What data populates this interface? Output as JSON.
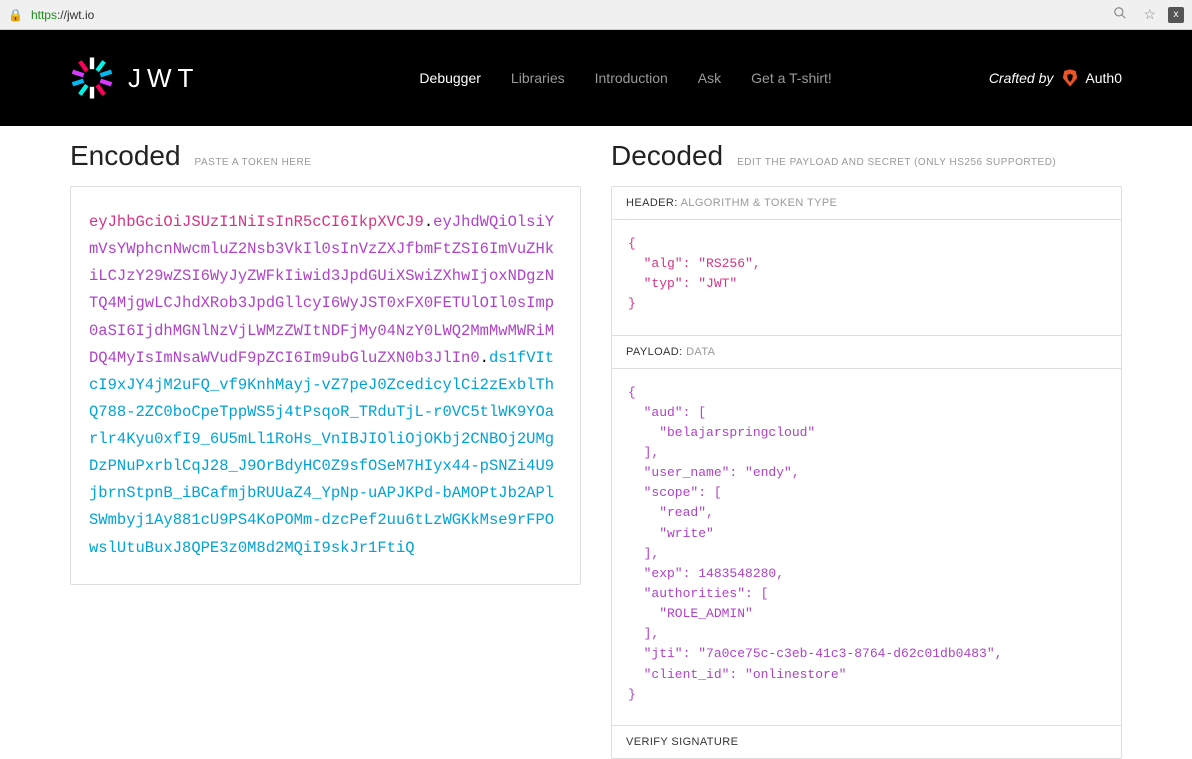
{
  "browser": {
    "url_proto": "https",
    "url_rest": "://jwt.io"
  },
  "header": {
    "logo_text": "JWT",
    "nav": {
      "debugger": "Debugger",
      "libraries": "Libraries",
      "introduction": "Introduction",
      "ask": "Ask",
      "tshirt": "Get a T-shirt!"
    },
    "crafted_by": "Crafted by",
    "auth0": "Auth0"
  },
  "encoded": {
    "title": "Encoded",
    "hint": "PASTE A TOKEN HERE",
    "token_header": "eyJhbGciOiJSUzI1NiIsInR5cCI6IkpXVCJ9",
    "token_payload": "eyJhdWQiOlsiYmVsYWphcnNwcmluZ2Nsb3VkIl0sInVzZXJfbmFtZSI6ImVuZHkiLCJzY29wZSI6WyJyZWFkIiwid3JpdGUiXSwiZXhwIjoxNDgzNTQ4MjgwLCJhdXRob3JpdGllcyI6WyJST0xFX0FETUlOIl0sImp0aSI6IjdhMGNlNzVjLWMzZWItNDFjMy04NzY0LWQ2MmMwMWRiMDQ4MyIsImNsaWVudF9pZCI6Im9ubGluZXN0b3JlIn0",
    "token_sig": "ds1fVItcI9xJY4jM2uFQ_vf9KnhMayj-vZ7peJ0ZcedicylCi2zExblThQ788-2ZC0boCpeTppWS5j4tPsqoR_TRduTjL-r0VC5tlWK9YOarlr4Kyu0xfI9_6U5mLl1RoHs_VnIBJIOliOjOKbj2CNBOj2UMgDzPNuPxrblCqJ28_J9OrBdyHC0Z9sfOSeM7HIyx44-pSNZi4U9jbrnStpnB_iBCafmjbRUUaZ4_YpNp-uAPJKPd-bAMOPtJb2APlSWmbyj1Ay881cU9PS4KoPOMm-dzcPef2uu6tLzWGKkMse9rFPOwslUtuBuxJ8QPE3z0M8d2MQiI9skJr1FtiQ"
  },
  "decoded": {
    "title": "Decoded",
    "hint": "EDIT THE PAYLOAD AND SECRET (ONLY HS256 SUPPORTED)",
    "header_label": "HEADER:",
    "header_sub": "ALGORITHM & TOKEN TYPE",
    "header_json": "{\n  \"alg\": \"RS256\",\n  \"typ\": \"JWT\"\n}",
    "payload_label": "PAYLOAD:",
    "payload_sub": "DATA",
    "payload_json": "{\n  \"aud\": [\n    \"belajarspringcloud\"\n  ],\n  \"user_name\": \"endy\",\n  \"scope\": [\n    \"read\",\n    \"write\"\n  ],\n  \"exp\": 1483548280,\n  \"authorities\": [\n    \"ROLE_ADMIN\"\n  ],\n  \"jti\": \"7a0ce75c-c3eb-41c3-8764-d62c01db0483\",\n  \"client_id\": \"onlinestore\"\n}",
    "verify_label": "VERIFY SIGNATURE"
  }
}
